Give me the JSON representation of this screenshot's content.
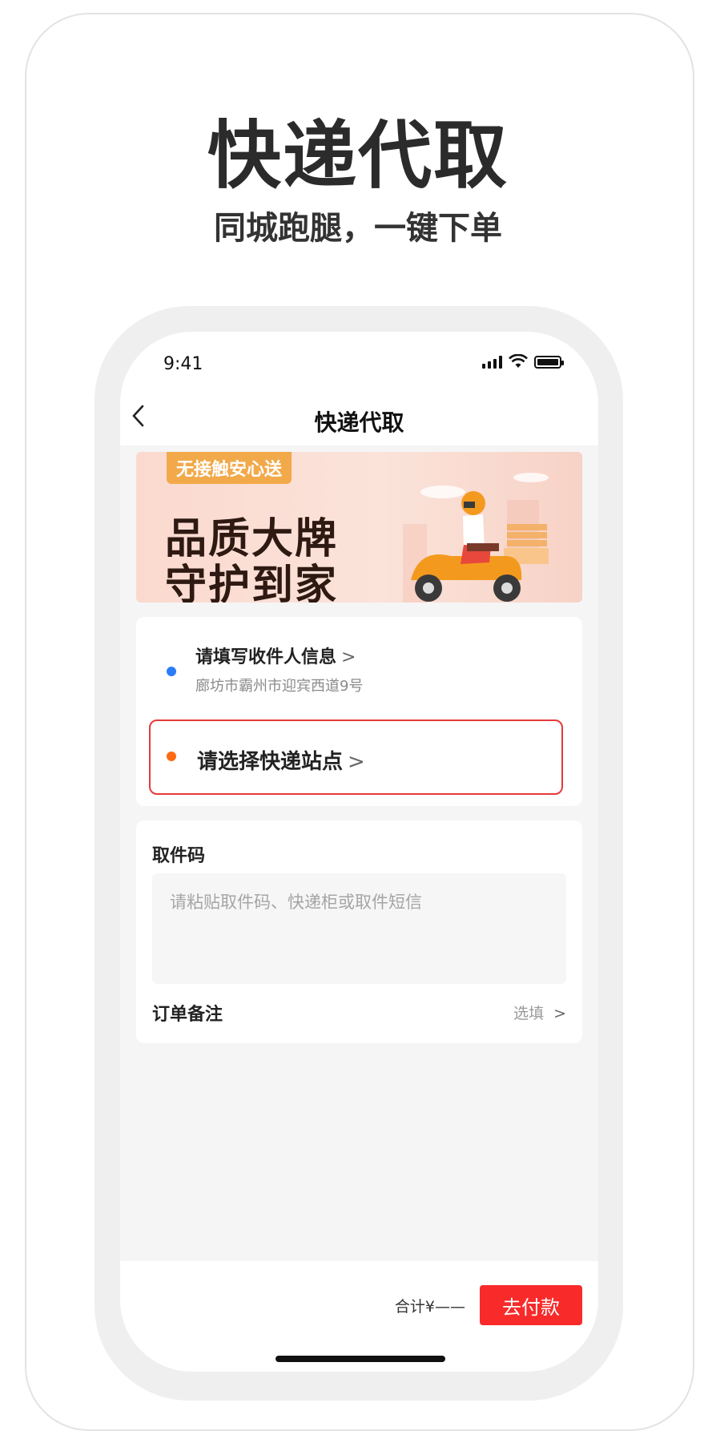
{
  "promo": {
    "title": "快递代取",
    "subtitle": "同城跑腿，一键下单"
  },
  "status_bar": {
    "time": "9:41",
    "icons": [
      "cellular-signal-icon",
      "wifi-icon",
      "battery-icon"
    ]
  },
  "nav": {
    "back_icon": "chevron-left-icon",
    "title": "快递代取"
  },
  "banner": {
    "tag": "无接触安心送",
    "line1": "品质大牌",
    "line2": "守护到家",
    "illustration": "delivery-scooter-illustration"
  },
  "address": {
    "receiver_title": "请填写收件人信息",
    "receiver_address": "廊坊市霸州市迎宾西道9号",
    "station_label": "请选择快递站点",
    "chevron": ">"
  },
  "pickup": {
    "code_label": "取件码",
    "input_placeholder": "请粘贴取件码、快递柜或取件短信",
    "input_value": "",
    "remark_label": "订单备注",
    "remark_value": "选填",
    "chevron": ">"
  },
  "checkout": {
    "total": "合计¥——",
    "pay_label": "去付款"
  },
  "colors": {
    "accent_red": "#f82a2a",
    "station_border": "#e8393a",
    "dot_blue": "#2b7cf6",
    "dot_orange": "#ff6a13",
    "banner_tag": "#f2a94a"
  }
}
